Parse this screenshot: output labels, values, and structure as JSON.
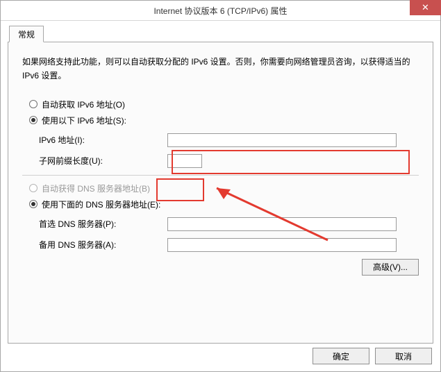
{
  "title": "Internet 协议版本 6 (TCP/IPv6) 属性",
  "close_glyph": "✕",
  "tabs": {
    "general": "常规"
  },
  "intro": "如果网络支持此功能，则可以自动获取分配的 IPv6 设置。否则，你需要向网络管理员咨询，以获得适当的 IPv6 设置。",
  "radios": {
    "auto_ip": "自动获取 IPv6 地址(O)",
    "manual_ip": "使用以下 IPv6 地址(S):",
    "auto_dns": "自动获得 DNS 服务器地址(B)",
    "manual_dns": "使用下面的 DNS 服务器地址(E):"
  },
  "fields": {
    "ip_label": "IPv6 地址(I):",
    "ip_value": "",
    "prefix_label": "子网前缀长度(U):",
    "prefix_value": "",
    "dns1_label": "首选 DNS 服务器(P):",
    "dns1_value": "",
    "dns2_label": "备用 DNS 服务器(A):",
    "dns2_value": ""
  },
  "buttons": {
    "advanced": "高级(V)...",
    "ok": "确定",
    "cancel": "取消"
  }
}
